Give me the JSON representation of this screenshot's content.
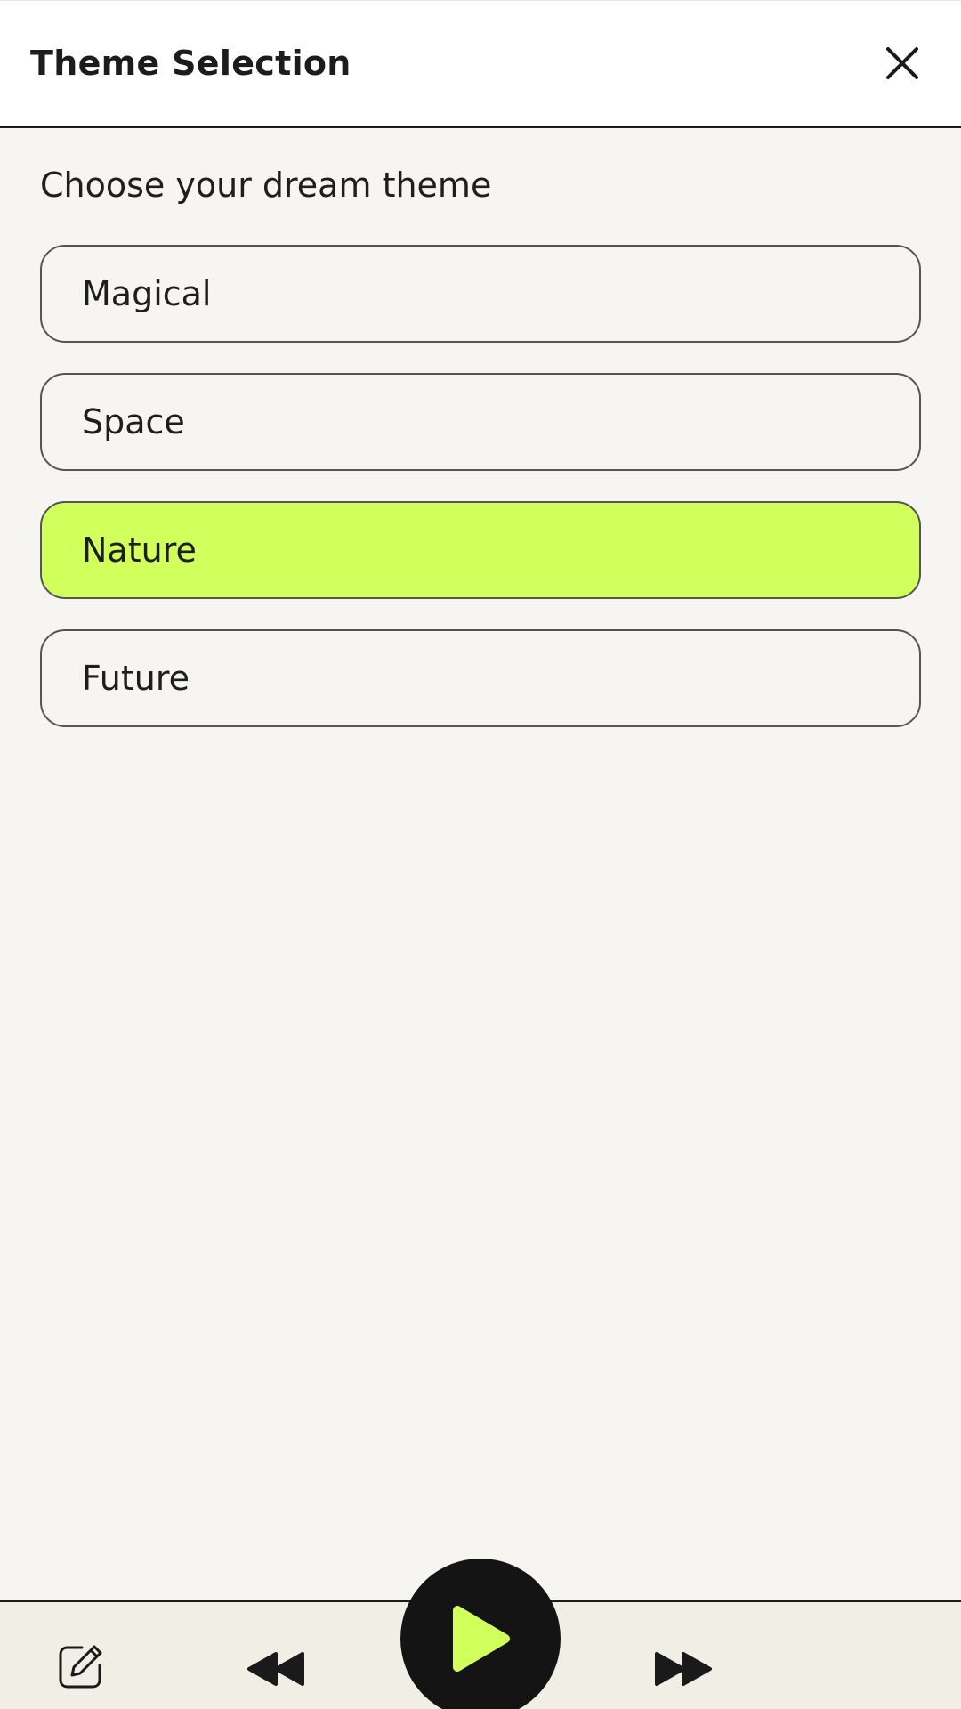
{
  "header": {
    "title": "Theme Selection",
    "close_icon": "close-icon"
  },
  "main": {
    "subtitle": "Choose your dream theme",
    "options": [
      {
        "label": "Magical",
        "selected": false
      },
      {
        "label": "Space",
        "selected": false
      },
      {
        "label": "Nature",
        "selected": true
      },
      {
        "label": "Future",
        "selected": false
      }
    ]
  },
  "player": {
    "edit_icon": "edit-icon",
    "rewind_icon": "rewind-icon",
    "play_icon": "play-icon",
    "forward_icon": "fast-forward-icon"
  },
  "colors": {
    "background": "#f6f5f1",
    "accent": "#d1ff5b",
    "dark": "#141414",
    "bottom_bar": "#f1efe5"
  }
}
